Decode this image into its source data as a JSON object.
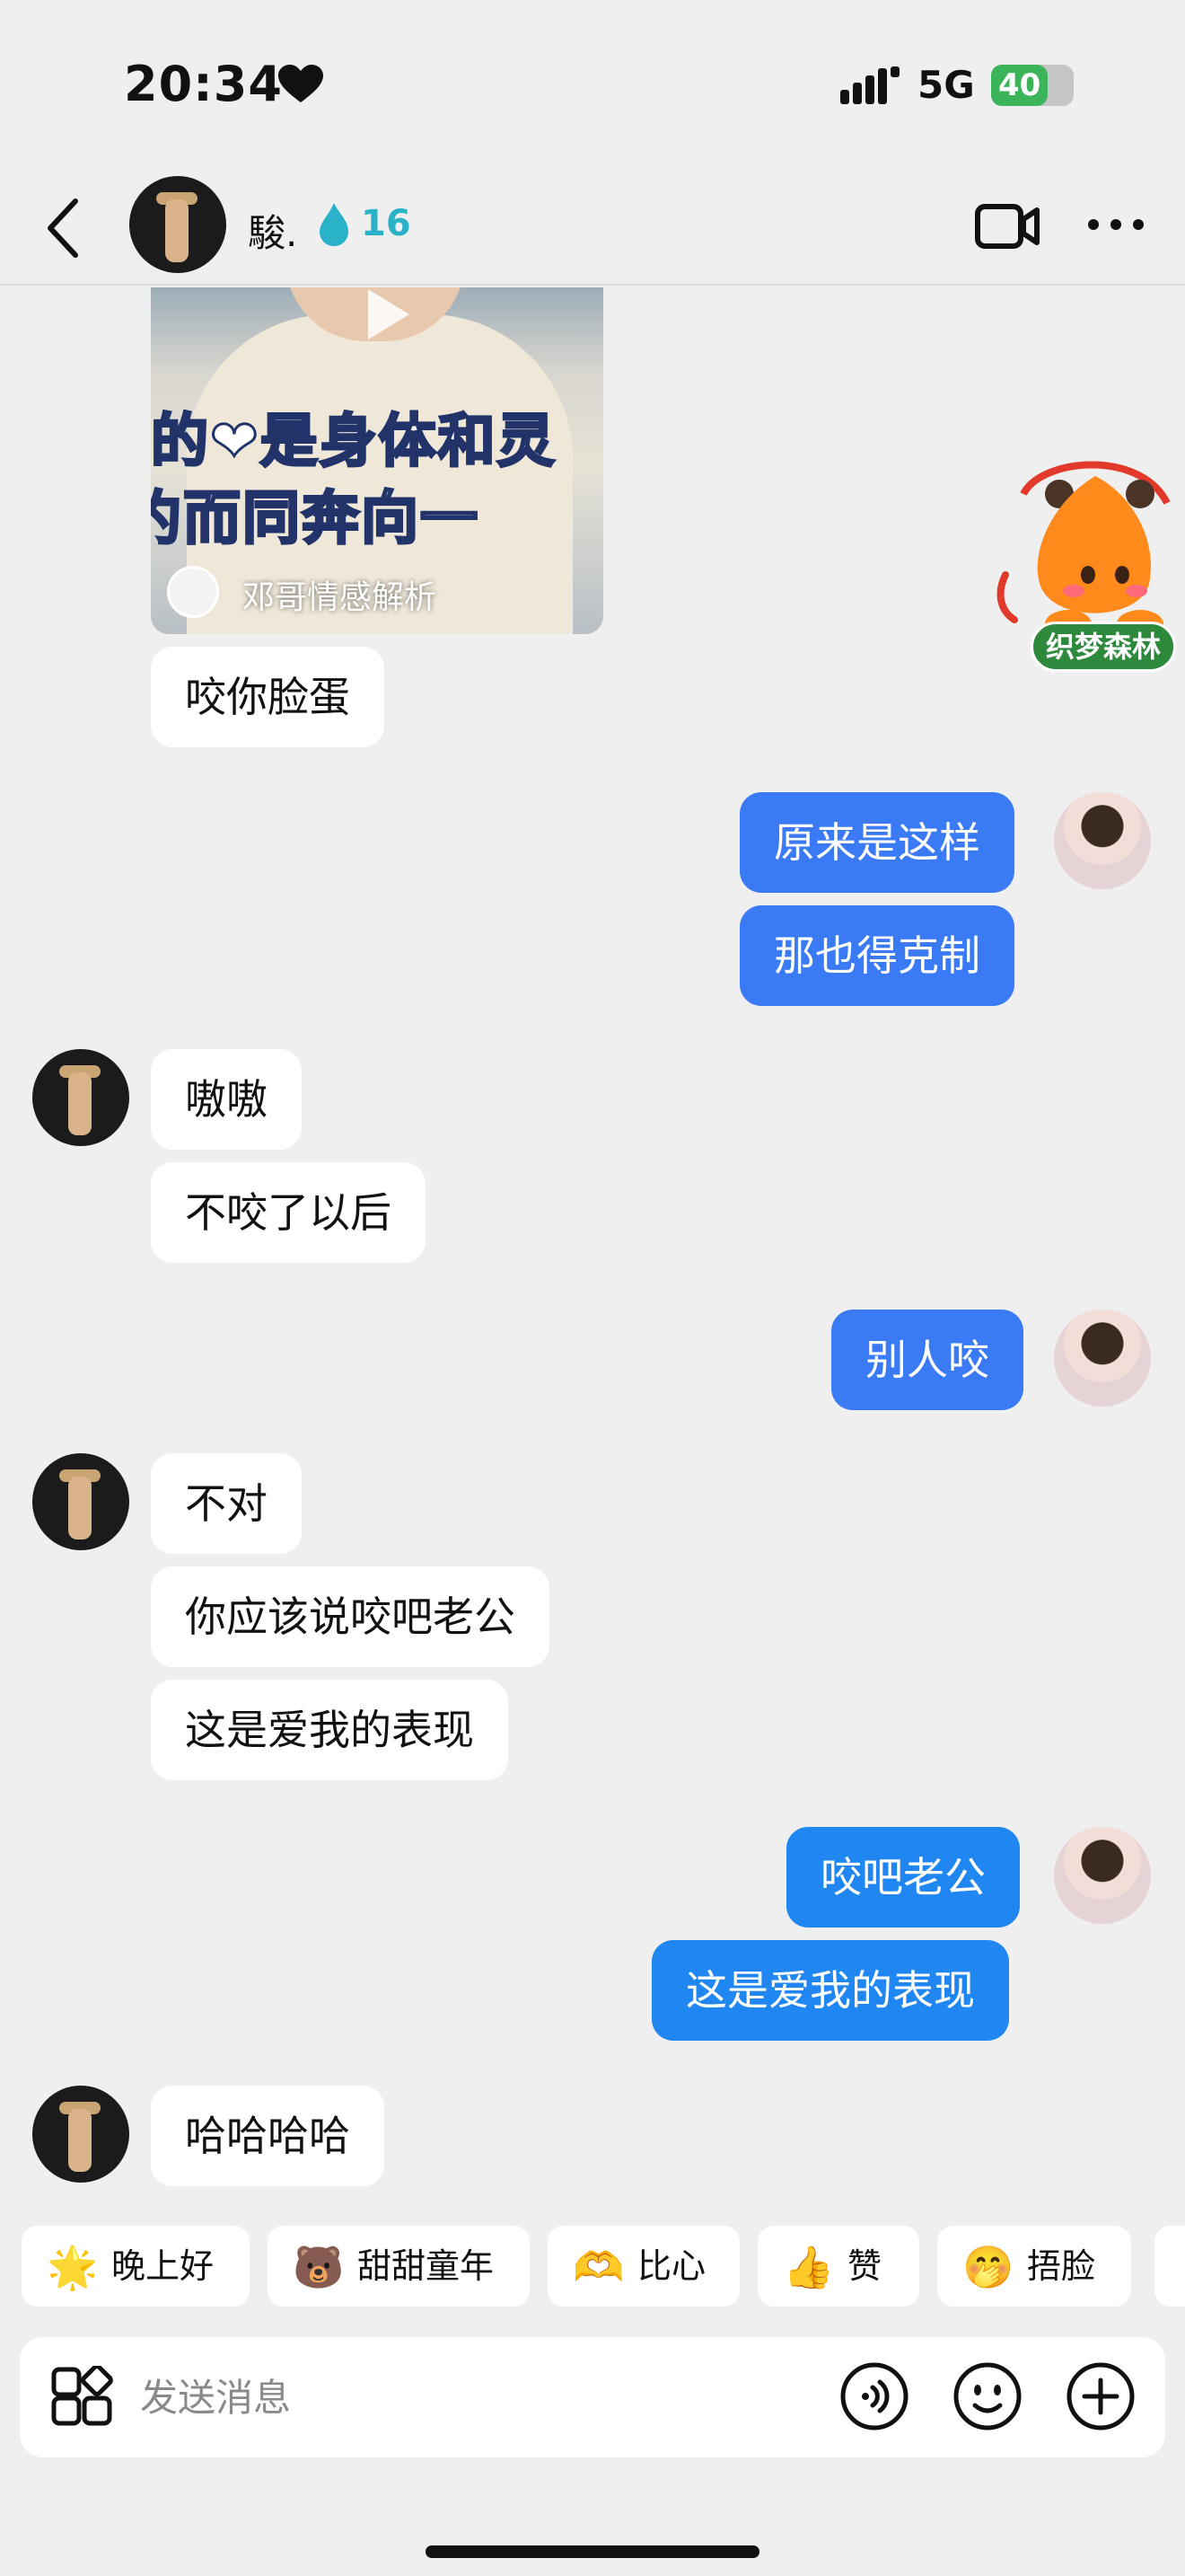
{
  "status_bar": {
    "time": "20:34",
    "network": "5G",
    "battery": "40",
    "battery_level": 0.4
  },
  "header": {
    "contact_name": "駿.",
    "streak_count": "16"
  },
  "video_card": {
    "caption_line1": "的❤是身体和灵",
    "caption_line2": "约而同奔向一",
    "author": "邓哥情感解析"
  },
  "mascot": {
    "label": "织梦森林"
  },
  "messages": [
    {
      "from": "peer",
      "text": "咬你脸蛋"
    },
    {
      "from": "me",
      "text": "原来是这样"
    },
    {
      "from": "me",
      "text": "那也得克制"
    },
    {
      "from": "peer",
      "text": "嗷嗷"
    },
    {
      "from": "peer",
      "text": "不咬了以后"
    },
    {
      "from": "me",
      "text": "别人咬"
    },
    {
      "from": "peer",
      "text": "不对"
    },
    {
      "from": "peer",
      "text": "你应该说咬吧老公"
    },
    {
      "from": "peer",
      "text": "这是爱我的表现"
    },
    {
      "from": "me",
      "text": "咬吧老公"
    },
    {
      "from": "me",
      "text": "这是爱我的表现"
    },
    {
      "from": "peer",
      "text": "哈哈哈哈"
    }
  ],
  "quick_replies": [
    {
      "emoji": "🌟",
      "label": "晚上好"
    },
    {
      "emoji": "🐻",
      "label": "甜甜童年"
    },
    {
      "emoji": "🫶",
      "label": "比心"
    },
    {
      "emoji": "👍",
      "label": "赞"
    },
    {
      "emoji": "🤭",
      "label": "捂脸"
    }
  ],
  "input": {
    "placeholder": "发送消息",
    "value": ""
  },
  "colors": {
    "outgoing_bubble": "#3b7af5",
    "outgoing_bubble_alt": "#1f86f2",
    "incoming_bubble": "#ffffff",
    "background": "#efefef",
    "streak": "#2ab3c8"
  },
  "icons": [
    "back-icon",
    "fire-icon",
    "video-call-icon",
    "more-icon",
    "play-icon",
    "apps-icon",
    "voice-icon",
    "emoji-icon",
    "plus-icon"
  ]
}
